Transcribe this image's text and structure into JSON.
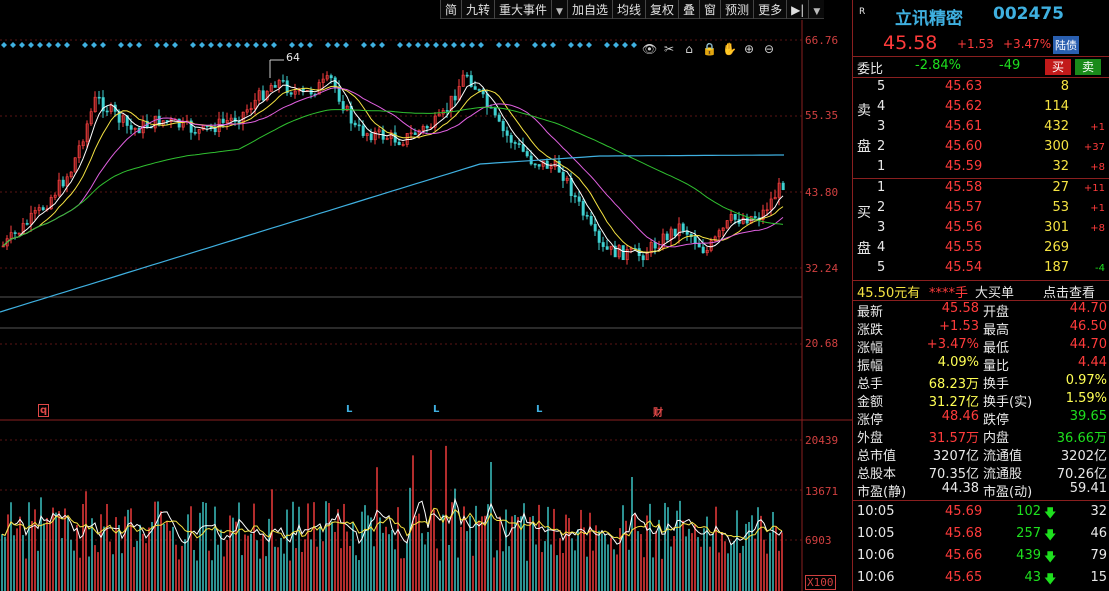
{
  "toolbar": {
    "items": [
      "简",
      "九转",
      "重大事件",
      "▼",
      "加自选",
      "均线",
      "复权",
      "叠",
      "窗",
      "预测",
      "更多",
      "▶|",
      "▼"
    ]
  },
  "chart": {
    "peak_label": "64",
    "y_labels_price": [
      "66.76",
      "55.35",
      "43.80",
      "32.24",
      "20.68"
    ],
    "y_labels_volume": [
      "20439",
      "13671",
      "6903",
      "X100"
    ],
    "markers": [
      {
        "text": "q",
        "type": "q"
      },
      {
        "text": "L",
        "type": "L"
      },
      {
        "text": "L",
        "type": "L"
      },
      {
        "text": "L",
        "type": "L"
      },
      {
        "text": "财",
        "type": "cai"
      }
    ],
    "tools": [
      "👁",
      "✂",
      "⌂",
      "🔒",
      "✋",
      "⊕",
      "⊖"
    ]
  },
  "quote": {
    "r_tag": "R",
    "name": "立讯精密",
    "code": "002475",
    "price": "45.58",
    "change": "+1.53",
    "pct": "+3.47%",
    "exchange_badge": "陆债",
    "weibi_label": "委比",
    "weibi": "-2.84%",
    "weicha": "-49",
    "sell_btn": "买",
    "buy_btn": "卖",
    "sell_label": [
      "卖",
      "盘"
    ],
    "buy_label": [
      "买",
      "盘"
    ],
    "asks": [
      {
        "lvl": "5",
        "price": "45.63",
        "vol": "8",
        "chg": ""
      },
      {
        "lvl": "4",
        "price": "45.62",
        "vol": "114",
        "chg": ""
      },
      {
        "lvl": "3",
        "price": "45.61",
        "vol": "432",
        "chg": "+1"
      },
      {
        "lvl": "2",
        "price": "45.60",
        "vol": "300",
        "chg": "+37"
      },
      {
        "lvl": "1",
        "price": "45.59",
        "vol": "32",
        "chg": "+8"
      }
    ],
    "bids": [
      {
        "lvl": "1",
        "price": "45.58",
        "vol": "27",
        "chg": "+11"
      },
      {
        "lvl": "2",
        "price": "45.57",
        "vol": "53",
        "chg": "+1"
      },
      {
        "lvl": "3",
        "price": "45.56",
        "vol": "301",
        "chg": "+8"
      },
      {
        "lvl": "4",
        "price": "45.55",
        "vol": "269",
        "chg": ""
      },
      {
        "lvl": "5",
        "price": "45.54",
        "vol": "187",
        "chg": "-4"
      }
    ],
    "big_order": {
      "price": "45.50元有",
      "vol": "****手",
      "label": "大买单",
      "link": "点击查看"
    },
    "stats": [
      {
        "k1": "最新",
        "v1": "45.58",
        "c1": "red",
        "k2": "开盘",
        "v2": "44.70",
        "c2": "red"
      },
      {
        "k1": "涨跌",
        "v1": "+1.53",
        "c1": "red",
        "k2": "最高",
        "v2": "46.50",
        "c2": "red"
      },
      {
        "k1": "涨幅",
        "v1": "+3.47%",
        "c1": "red",
        "k2": "最低",
        "v2": "44.70",
        "c2": "red"
      },
      {
        "k1": "振幅",
        "v1": "4.09%",
        "c1": "cyan",
        "k2": "量比",
        "v2": "4.44",
        "c2": "red"
      },
      {
        "k1": "总手",
        "v1": "68.23万",
        "c1": "cyan",
        "k2": "换手",
        "v2": "0.97%",
        "c2": "cyan"
      },
      {
        "k1": "金额",
        "v1": "31.27亿",
        "c1": "cyan",
        "k2": "换手(实)",
        "v2": "1.59%",
        "c2": "cyan"
      },
      {
        "k1": "涨停",
        "v1": "48.46",
        "c1": "red",
        "k2": "跌停",
        "v2": "39.65",
        "c2": "green"
      },
      {
        "k1": "外盘",
        "v1": "31.57万",
        "c1": "red",
        "k2": "内盘",
        "v2": "36.66万",
        "c2": "green"
      },
      {
        "k1": "总市值",
        "v1": "3207亿",
        "c1": "white",
        "k2": "流通值",
        "v2": "3202亿",
        "c2": "white"
      },
      {
        "k1": "总股本",
        "v1": "70.35亿",
        "c1": "white",
        "k2": "流通股",
        "v2": "70.26亿",
        "c2": "white"
      },
      {
        "k1": "市盈(静)",
        "v1": "44.38",
        "c1": "white",
        "k2": "市盈(动)",
        "v2": "59.41",
        "c2": "white"
      }
    ],
    "ticks": [
      {
        "time": "10:05",
        "price": "45.69",
        "vol": "102",
        "dir": "down",
        "n": "32"
      },
      {
        "time": "10:05",
        "price": "45.68",
        "vol": "257",
        "dir": "down",
        "n": "46"
      },
      {
        "time": "10:06",
        "price": "45.66",
        "vol": "439",
        "dir": "down",
        "n": "79"
      },
      {
        "time": "10:06",
        "price": "45.65",
        "vol": "43",
        "dir": "down",
        "n": "15"
      }
    ]
  }
}
